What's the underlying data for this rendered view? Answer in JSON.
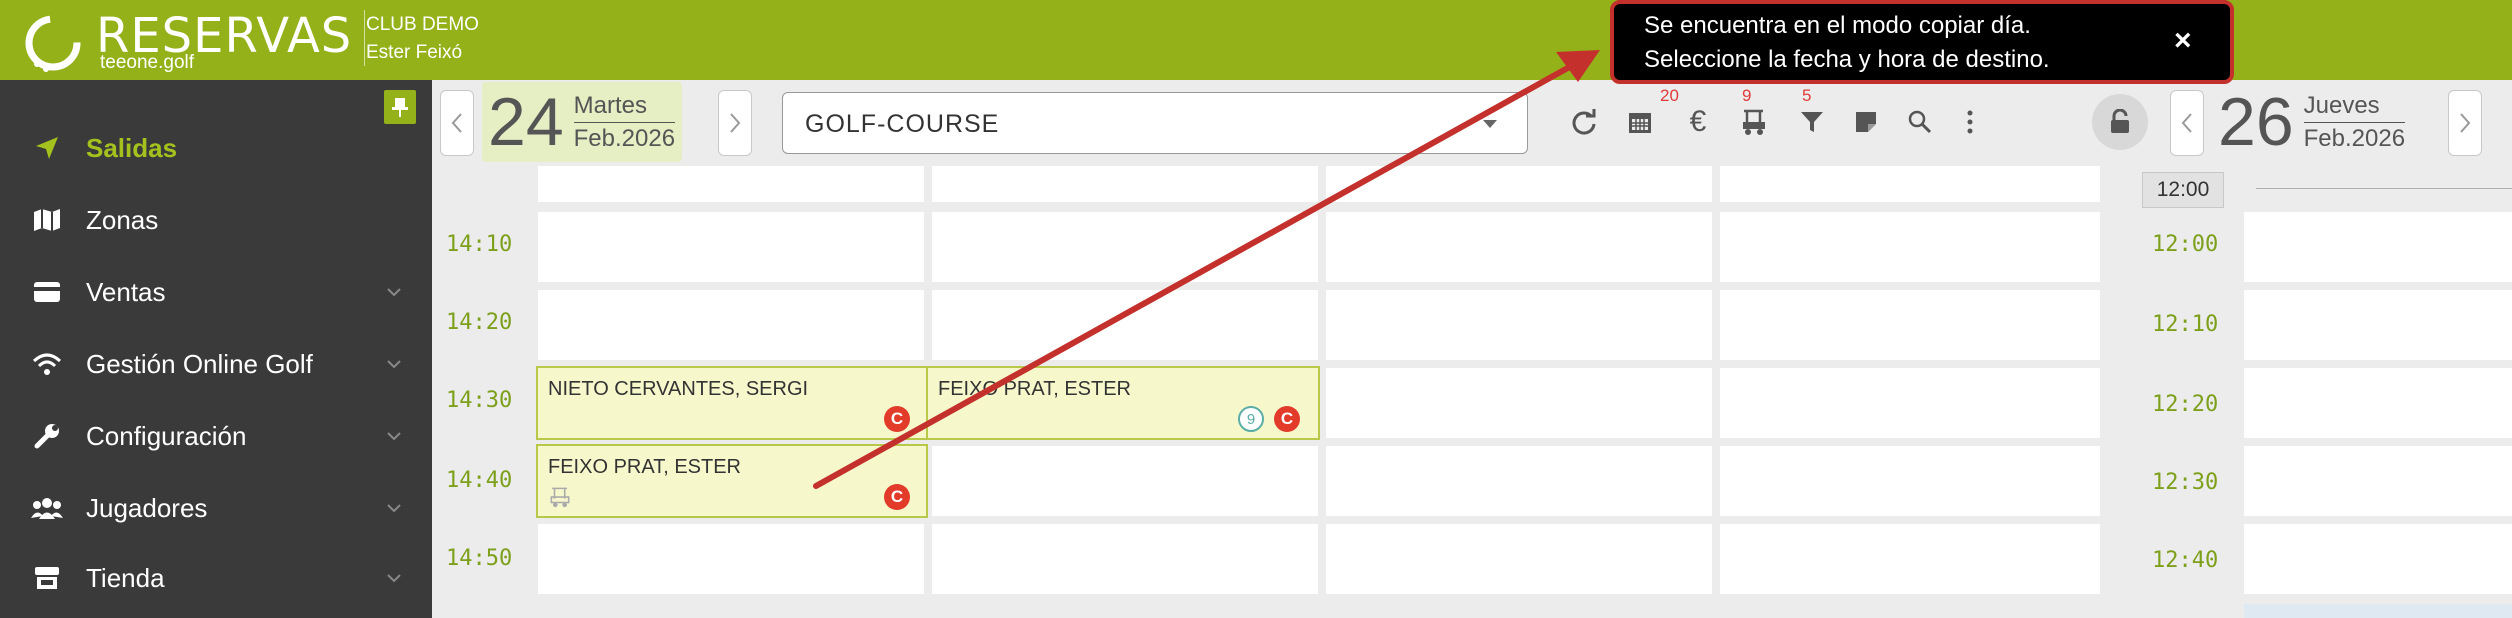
{
  "app": {
    "logo_title": "RESERVAS",
    "logo_sub": "teeone.golf",
    "club_name": "CLUB DEMO",
    "user_name": "Ester Feixó",
    "brand_color": "#94b11a"
  },
  "sidebar": {
    "items": [
      {
        "label": "Salidas",
        "icon": "paper-plane-icon",
        "active": true
      },
      {
        "label": "Zonas",
        "icon": "map-icon"
      },
      {
        "label": "Ventas",
        "icon": "credit-card-icon",
        "expandable": true
      },
      {
        "label": "Gestión Online Golf",
        "icon": "wifi-icon",
        "expandable": true
      },
      {
        "label": "Configuración",
        "icon": "wrench-icon",
        "expandable": true
      },
      {
        "label": "Jugadores",
        "icon": "users-icon",
        "expandable": true
      },
      {
        "label": "Tienda",
        "icon": "store-icon",
        "expandable": true
      }
    ]
  },
  "toolbar": {
    "left_date": {
      "day": "24",
      "weekday": "Martes",
      "month_year": "Feb.2026"
    },
    "course": "GOLF-COURSE",
    "badges": {
      "calendar": "20",
      "euro": "9",
      "cart": "5"
    },
    "right_date": {
      "day": "26",
      "weekday": "Jueves",
      "month_year": "Feb.2026"
    }
  },
  "teesheet": {
    "times": [
      "14:10",
      "14:20",
      "14:30",
      "14:40",
      "14:50"
    ],
    "bookings": [
      {
        "name": "NIETO CERVANTES, SERGI"
      },
      {
        "name": "FEIXO PRAT, ESTER"
      },
      {
        "name": "FEIXO PRAT, ESTER"
      }
    ],
    "holes_badge": "9",
    "status_badge": "C"
  },
  "right_sheet": {
    "header_time": "12:00",
    "times": [
      "12:00",
      "12:10",
      "12:20",
      "12:30",
      "12:40"
    ]
  },
  "toast": {
    "line1": "Se encuentra en el modo copiar día.",
    "line2": "Seleccione la fecha y hora de destino.",
    "close": "×"
  }
}
